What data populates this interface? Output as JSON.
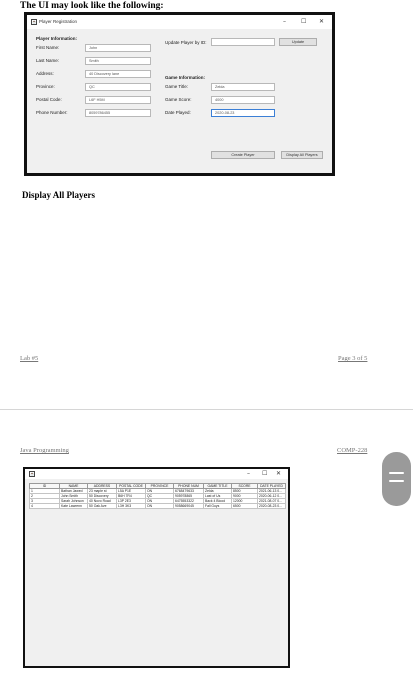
{
  "page1": {
    "heading": "The UI may look like the following:",
    "section_heading": "Display All Players",
    "footer_left": "Lab #5",
    "footer_right": "Page 3 of 5"
  },
  "page2": {
    "header_left": "Java Programming",
    "header_right": "COMP-228"
  },
  "registration_window": {
    "icon": "java-app-icon",
    "title": "Player Registration",
    "controls": [
      "–",
      "☐",
      "✕"
    ],
    "player_info_heading": "Player Information:",
    "fields": [
      {
        "label": "First Name:",
        "value": "John"
      },
      {
        "label": "Last Name:",
        "value": "Smith"
      },
      {
        "label": "Address:",
        "value": "40 Discovery lane"
      },
      {
        "label": "Province:",
        "value": "QC"
      },
      {
        "label": "Postal Code:",
        "value": "L6F H5M"
      },
      {
        "label": "Phone Number:",
        "value": "8059786455"
      }
    ],
    "update_label": "Update Player by ID:",
    "update_value": "",
    "update_button": "Update",
    "game_info_heading": "Game Information:",
    "game_fields": [
      {
        "label": "Game Title:",
        "value": "Zelda"
      },
      {
        "label": "Game Score:",
        "value": "4000"
      },
      {
        "label": "Date Played:",
        "value": "2020-08-23"
      }
    ],
    "create_button": "Create Player",
    "display_button": "Display All Players"
  },
  "players_window": {
    "icon": "java-app-icon",
    "controls": [
      "–",
      "☐",
      "✕"
    ],
    "columns": [
      "ID",
      "NAME",
      "ADDRESS",
      "POSTAL CODE",
      "PROVINCE",
      "PHONE NUM",
      "GAME TITLE",
      "SCORE",
      "DATE PLAYED"
    ],
    "rows": [
      [
        "1",
        "Bathan Jawed",
        "23 maple st",
        "L5A P1E",
        "ON",
        "6768479633",
        "Zelda",
        "8500",
        "2021-06-13 0..."
      ],
      [
        "2",
        "John Smith",
        "50 Discovery",
        "B6H 7R4",
        "QC",
        "905978865",
        "Last of Us",
        "9000",
        "2020-06-12 0..."
      ],
      [
        "3",
        "Sarah Johnson",
        "40 Novo Road",
        "L3P 2E3",
        "ON",
        "6475553322",
        "Back 4 Blood",
        "12000",
        "2021-08-07 0..."
      ],
      [
        "4",
        "Kate Lawrenn",
        "50 Oak Ave",
        "L3H 3K3",
        "ON",
        "9058669045",
        "Fall Guys",
        "6500",
        "2020-08-23 0..."
      ]
    ]
  },
  "colors": {
    "accent": "#3b7fd6",
    "window_bg": "#f0f0f0",
    "fab": "#9a9a9a"
  }
}
